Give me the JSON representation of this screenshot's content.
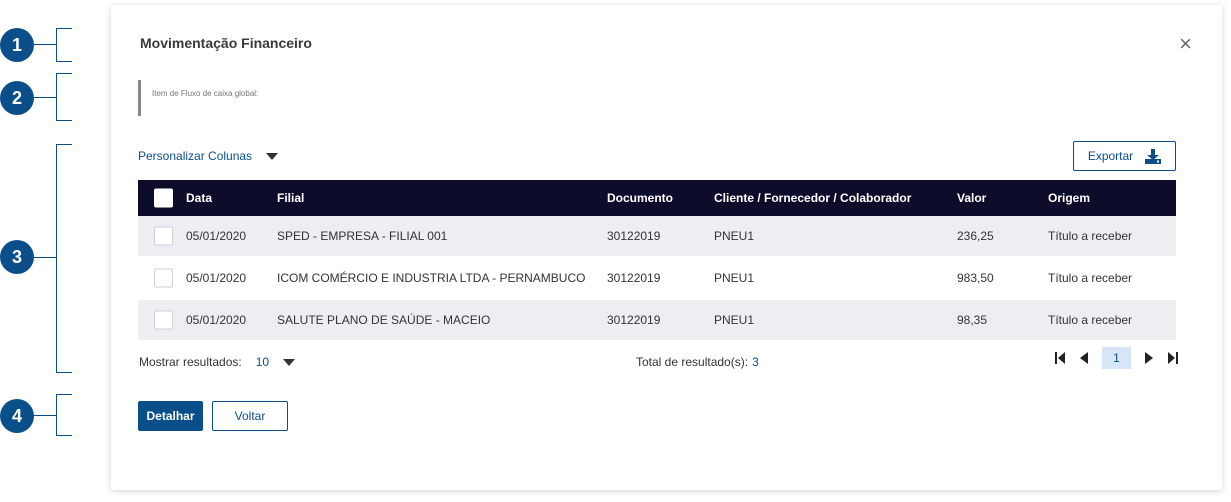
{
  "markers": [
    "1",
    "2",
    "3",
    "4"
  ],
  "modal": {
    "title": "Movimentação Financeiro",
    "close_icon": "×",
    "fluxo_label": "Item de Fluxo de caixa global:"
  },
  "toolbar": {
    "personalizar_label": "Personalizar Colunas",
    "exportar_label": "Exportar"
  },
  "table": {
    "headers": {
      "data": "Data",
      "filial": "Filial",
      "documento": "Documento",
      "cliente": "Cliente / Fornecedor / Colaborador",
      "valor": "Valor",
      "origem": "Origem"
    },
    "rows": [
      {
        "data": "05/01/2020",
        "filial": "SPED - EMPRESA - FILIAL 001",
        "documento": "30122019",
        "cliente": "PNEU1",
        "valor": "236,25",
        "origem": "Título a receber"
      },
      {
        "data": "05/01/2020",
        "filial": "ICOM COMÉRCIO E INDUSTRIA LTDA - PERNAMBUCO",
        "documento": "30122019",
        "cliente": "PNEU1",
        "valor": "983,50",
        "origem": "Título a receber"
      },
      {
        "data": "05/01/2020",
        "filial": "SALUTE PLANO DE SAÚDE - MACEIO",
        "documento": "30122019",
        "cliente": "PNEU1",
        "valor": "98,35",
        "origem": "Título a receber"
      }
    ]
  },
  "pagination": {
    "mostrar_label": "Mostrar resultados:",
    "per_page": "10",
    "total_label": "Total de resultado(s):",
    "total_value": "3",
    "current_page": "1"
  },
  "actions": {
    "detalhar_label": "Detalhar",
    "voltar_label": "Voltar"
  },
  "colors": {
    "primary": "#0b4f8a",
    "header_bg": "#0d0d2b",
    "row_alt": "#eeeef2"
  }
}
